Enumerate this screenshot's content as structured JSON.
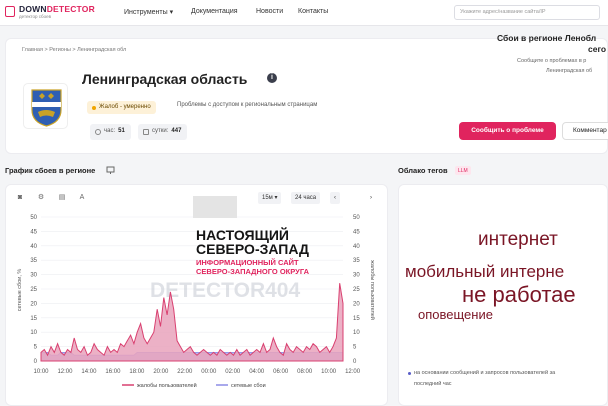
{
  "header": {
    "logo_title_a": "DOWN",
    "logo_title_b": "DETECTOR",
    "logo_sub": "детектор сбоев",
    "nav": {
      "tools": "Инструменты ▾",
      "docs": "Документация",
      "news": "Новости",
      "contacts": "Контакты"
    },
    "search_placeholder": "Укажите адрес/название сайта/IP"
  },
  "breadcrumb": "Главная  >  Регионы  >  Ленинградская обл",
  "region": {
    "title": "Ленинградская область",
    "badge": "Жалоб - умеренно",
    "badge_desc": "Проблемы с доступом к региональным страницам",
    "hour_label": "час:",
    "hour_value": "51",
    "day_label": "сутки:",
    "day_value": "447"
  },
  "side": {
    "title": "Сбои в регионе Ленобл",
    "title2": "сего",
    "sub1": "Сообщите о проблемах в р",
    "sub2": "Ленинградская об",
    "report_button": "Сообщить о проблеме",
    "comment_button": "Комментар"
  },
  "chart_section": {
    "title": "График сбоев в регионе",
    "controls": {
      "interval": "15м ▾",
      "range": "24 часа",
      "prev": "‹",
      "next": "›"
    },
    "legend": {
      "complaints": "жалобы пользователей",
      "outages": "сетевые сбои"
    }
  },
  "watermark": {
    "line1": "НАСТОЯЩИЙ",
    "line2": "СЕВЕРО-ЗАПАД",
    "line3": "ИНФОРМАЦИОННЫЙ САЙТ",
    "line4": "СЕВЕРО-ЗАПАДНОГО ОКРУГА",
    "bg_text": "DETECTOR404"
  },
  "cloud_section": {
    "title": "Облако тегов",
    "llm": "LLM",
    "tags": [
      "интернет",
      "мобильный интерне",
      "не работае",
      "оповещение"
    ],
    "note_line1": "на основании сообщений и запросов пользователей за",
    "note_line2": "последний час"
  },
  "colors": {
    "accent": "#e0245e",
    "complaints": "#d94070",
    "outages": "#8c8ce6",
    "tag": "#7a1525"
  },
  "chart_data": {
    "type": "area",
    "x": [
      "10:00",
      "12:00",
      "14:00",
      "16:00",
      "18:00",
      "20:00",
      "22:00",
      "00:00",
      "02:00",
      "04:00",
      "06:00",
      "08:00",
      "10:00",
      "12:00"
    ],
    "ylabel": "сетевые сбои, %",
    "y2label": "жалобы пользователей",
    "ylim": [
      0,
      50
    ],
    "y2lim": [
      0,
      50
    ],
    "y_ticks": [
      0,
      5,
      10,
      15,
      20,
      25,
      30,
      35,
      40,
      45,
      50
    ],
    "series": [
      {
        "name": "жалобы пользователей",
        "values": [
          3,
          4,
          2,
          5,
          3,
          6,
          3,
          2,
          4,
          3,
          8,
          4,
          3,
          5,
          2,
          3,
          6,
          4,
          3,
          2,
          5,
          3,
          4,
          3,
          6,
          5,
          7,
          9,
          6,
          10,
          13,
          8,
          6,
          8,
          10,
          18,
          12,
          22,
          16,
          24,
          18,
          7,
          5,
          3,
          4,
          5,
          3,
          2,
          3,
          4,
          3,
          2,
          3,
          2,
          4,
          3,
          2,
          3,
          2,
          4,
          2,
          3,
          4,
          2,
          3,
          4,
          3,
          6,
          3,
          4,
          8,
          5,
          3,
          2,
          6,
          4,
          3,
          5,
          4,
          3,
          5,
          4,
          6,
          5,
          3,
          4,
          5,
          3,
          5,
          8,
          27,
          20
        ]
      },
      {
        "name": "сетевые сбои",
        "values": [
          3,
          3,
          3,
          2,
          2,
          2,
          3,
          3,
          3,
          3,
          2,
          2,
          2,
          2,
          2,
          2,
          2,
          2,
          2,
          2,
          2,
          2,
          2,
          2,
          2,
          2,
          2,
          2,
          2,
          3,
          3,
          3,
          3,
          3,
          3,
          3,
          3,
          3,
          3,
          3,
          3,
          3,
          3,
          3,
          3,
          3,
          3,
          3,
          3,
          3,
          3,
          3,
          3,
          3,
          3,
          3,
          3,
          3,
          3,
          3,
          3,
          3,
          3,
          3,
          3,
          3,
          3,
          3,
          3,
          3,
          3,
          3,
          3,
          3,
          3,
          3,
          3,
          3,
          3,
          3,
          3,
          3,
          3,
          3,
          3,
          3,
          3,
          3,
          3,
          3,
          3,
          3
        ]
      }
    ]
  }
}
